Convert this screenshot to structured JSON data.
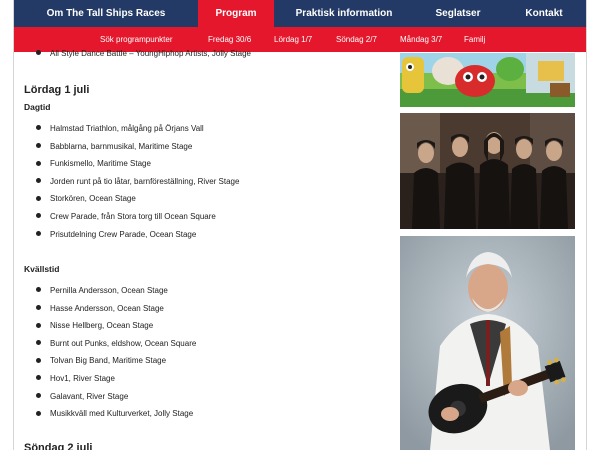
{
  "top_nav": {
    "items": [
      {
        "label": "Om The Tall Ships Races",
        "active": false
      },
      {
        "label": "Program",
        "active": true
      },
      {
        "label": "Praktisk information",
        "active": false
      },
      {
        "label": "Seglatser",
        "active": false
      },
      {
        "label": "Kontakt",
        "active": false
      }
    ]
  },
  "sub_nav": {
    "items": [
      {
        "label": "Sök programpunkter"
      },
      {
        "label": "Fredag 30/6"
      },
      {
        "label": "Lördag 1/7"
      },
      {
        "label": "Söndag 2/7"
      },
      {
        "label": "Måndag 3/7"
      },
      {
        "label": "Familj"
      }
    ]
  },
  "content": {
    "prev_item": "All Style Dance Battle – YoungHiphop Artists, Jolly Stage",
    "day_heading": "Lördag 1 juli",
    "dagtid": {
      "heading": "Dagtid",
      "items": [
        "Halmstad Triathlon, målgång på Örjans Vall",
        "Babblarna, barnmusikal, Maritime Stage",
        "Funkismello, Maritime Stage",
        "Jorden runt på tio låtar, barnföreställning, River Stage",
        "Storkören, Ocean Stage",
        "Crew Parade, från Stora torg till Ocean Square",
        "Prisutdelning Crew Parade, Ocean Stage"
      ]
    },
    "kvallstid": {
      "heading": "Kvällstid",
      "items": [
        "Pernilla Andersson, Ocean Stage",
        "Hasse Andersson, Ocean Stage",
        "Nisse Hellberg, Ocean Stage",
        "Burnt out Punks, eldshow, Ocean Square",
        "Tolvan Big Band, Maritime Stage",
        "Hov1, River Stage",
        "Galavant, River Stage",
        "Musikkväll med Kulturverket, Jolly Stage"
      ]
    },
    "next_heading": "Söndag 2 juli"
  },
  "photos": [
    {
      "name": "babblarna-photo"
    },
    {
      "name": "band-photo"
    },
    {
      "name": "guitarist-photo"
    }
  ],
  "colors": {
    "nav_dark": "#233a66",
    "nav_red": "#e4172c"
  }
}
